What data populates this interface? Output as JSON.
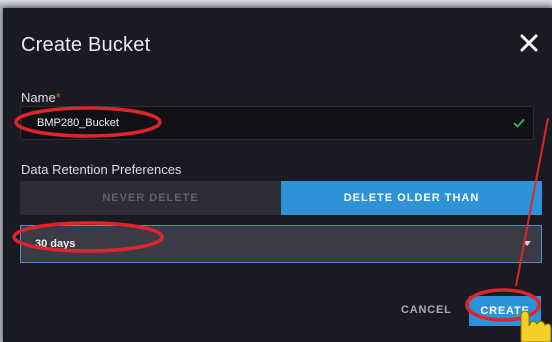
{
  "dialog": {
    "title": "Create Bucket",
    "close_icon": "close-icon"
  },
  "name_field": {
    "label": "Name",
    "required_marker": "*",
    "value": "BMP280_Bucket",
    "valid_icon": "check-icon"
  },
  "retention": {
    "label": "Data Retention Preferences",
    "options": [
      {
        "label": "NEVER DELETE",
        "selected": false
      },
      {
        "label": "DELETE OLDER THAN",
        "selected": true
      }
    ],
    "duration": {
      "value": "30 days",
      "icon": "chevron-down-icon"
    }
  },
  "actions": {
    "cancel_label": "CANCEL",
    "create_label": "CREATE"
  },
  "annotations": {
    "highlight_color": "#e0242c",
    "cursor_icon": "hand-pointer-icon",
    "cursor_color": "#f2d024"
  },
  "colors": {
    "accent": "#2d93d8",
    "dialog_bg": "#1a1a22",
    "valid": "#3fb56b"
  }
}
